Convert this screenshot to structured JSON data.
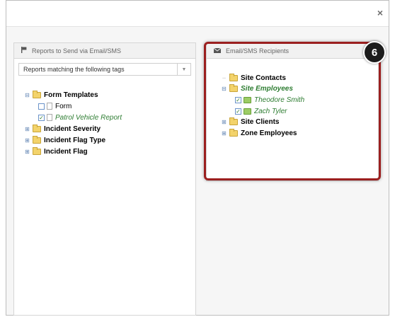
{
  "dialog": {
    "close_icon": "×"
  },
  "left_panel": {
    "title": "Reports to Send via Email/SMS",
    "filter_select": "Reports matching the following tags",
    "tree": [
      {
        "label": "Form Templates",
        "style": "bold",
        "expander": "−",
        "children": [
          {
            "label": "Form",
            "checked": false
          },
          {
            "label": "Patrol Vehicle Report",
            "checked": true
          }
        ]
      },
      {
        "label": "Incident Severity",
        "style": "bold",
        "expander": "+"
      },
      {
        "label": "Incident Flag Type",
        "style": "bold",
        "expander": "+"
      },
      {
        "label": "Incident Flag",
        "style": "bold",
        "expander": "+"
      }
    ]
  },
  "right_panel": {
    "title": "Email/SMS Recipients",
    "tree": [
      {
        "label": "Site Contacts",
        "style": "bold"
      },
      {
        "label": "Site Employees",
        "style": "bold-green",
        "expander": "−",
        "children": [
          {
            "label": "Theodore Smith",
            "checked": true
          },
          {
            "label": "Zach Tyler",
            "checked": true
          }
        ]
      },
      {
        "label": "Site Clients",
        "style": "bold",
        "expander": "+"
      },
      {
        "label": "Zone Employees",
        "style": "bold",
        "expander": "+"
      }
    ]
  },
  "annotation": {
    "step_number": "6",
    "highlight_color": "#9b1f1f"
  },
  "colors": {
    "checked_text": "#2e7d32",
    "folder": "#f3d36b"
  }
}
